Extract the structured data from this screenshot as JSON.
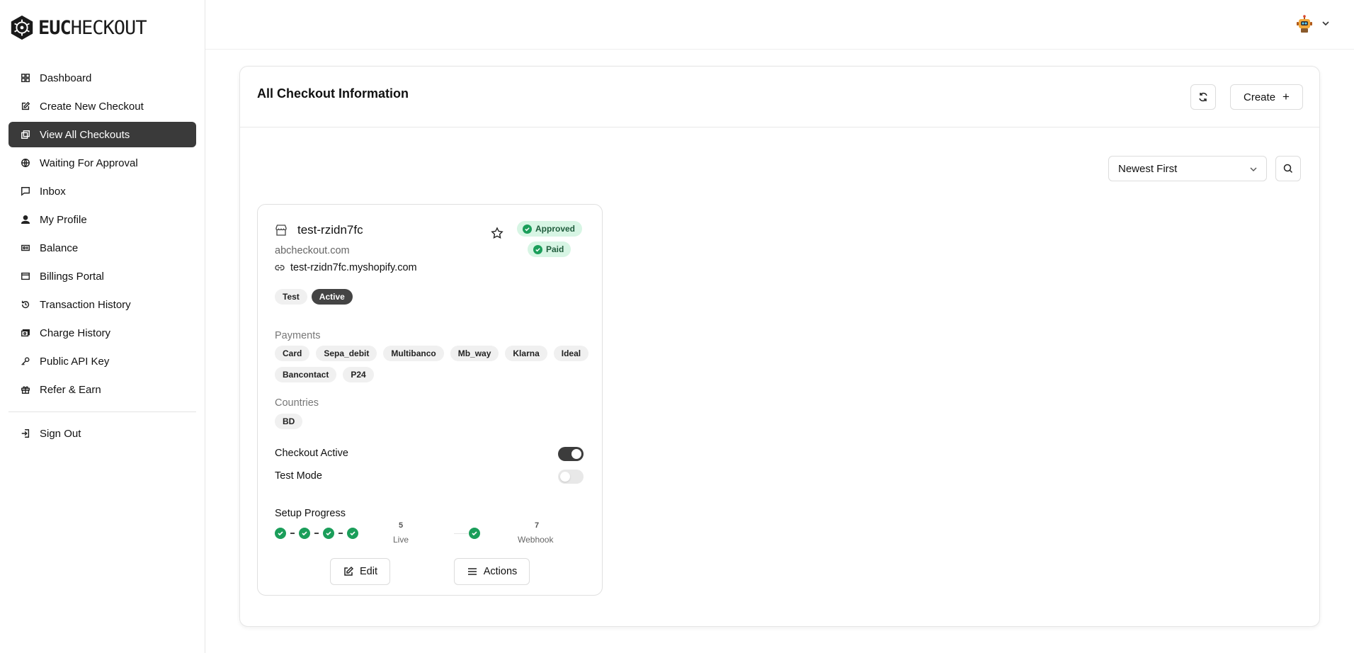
{
  "brand": {
    "logo_bold": "EUC",
    "logo_rest": "HECKOUT"
  },
  "sidebar": {
    "items": [
      {
        "label": "Dashboard",
        "icon": "grid-icon"
      },
      {
        "label": "Create New Checkout",
        "icon": "edit-square-icon"
      },
      {
        "label": "View All Checkouts",
        "icon": "copy-icon"
      },
      {
        "label": "Waiting For Approval",
        "icon": "globe-icon"
      },
      {
        "label": "Inbox",
        "icon": "message-icon"
      },
      {
        "label": "My Profile",
        "icon": "user-icon"
      },
      {
        "label": "Balance",
        "icon": "wallet-icon"
      },
      {
        "label": "Billings Portal",
        "icon": "credit-card-icon"
      },
      {
        "label": "Transaction History",
        "icon": "history-icon"
      },
      {
        "label": "Charge History",
        "icon": "banknote-icon"
      },
      {
        "label": "Public API Key",
        "icon": "key-icon"
      },
      {
        "label": "Refer & Earn",
        "icon": "gift-icon"
      }
    ],
    "active_index": 2,
    "sign_out": {
      "label": "Sign Out",
      "icon": "sign-out-icon"
    }
  },
  "header": {
    "avatar": "robot-avatar"
  },
  "panel": {
    "title": "All Checkout Information",
    "create_label": "Create",
    "sort": {
      "selected": "Newest First"
    }
  },
  "card": {
    "title": "test-rzidn7fc",
    "badges": {
      "approved": "Approved",
      "paid": "Paid"
    },
    "domain": "abcheckout.com",
    "store_url": "test-rzidn7fc.myshopify.com",
    "tags": [
      "Test",
      "Active"
    ],
    "payments_label": "Payments",
    "payments": [
      "Card",
      "Sepa_debit",
      "Multibanco",
      "Mb_way",
      "Klarna",
      "Ideal",
      "Bancontact",
      "P24"
    ],
    "countries_label": "Countries",
    "countries": [
      "BD"
    ],
    "checkout_active_label": "Checkout Active",
    "checkout_active": true,
    "test_mode_label": "Test Mode",
    "test_mode": false,
    "setup_progress_label": "Setup Progress",
    "steps": {
      "live_num": "5",
      "live_label": "Live",
      "webhook_num": "7",
      "webhook_label": "Webhook"
    },
    "edit_label": "Edit",
    "actions_label": "Actions"
  },
  "colors": {
    "accent_dark": "#3a3a3a",
    "success": "#1b9e5a",
    "success_bg": "#d7f5e4"
  }
}
